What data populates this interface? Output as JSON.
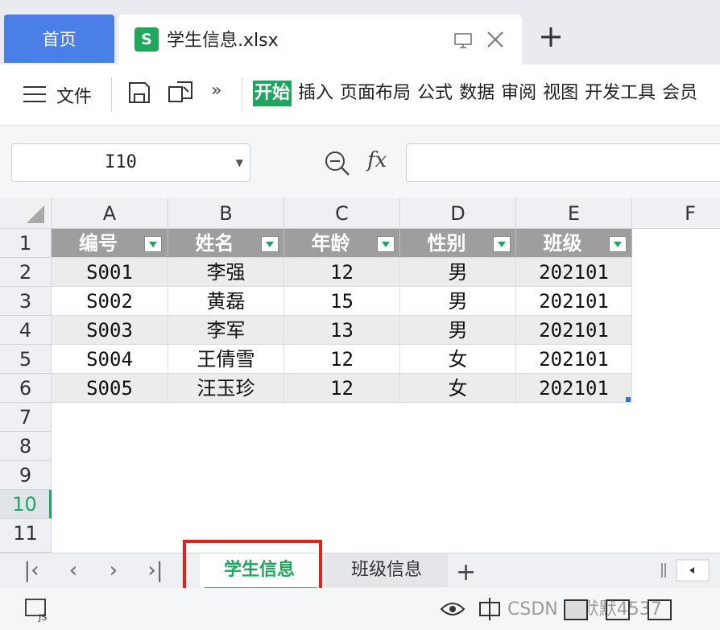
{
  "tabs": {
    "home": "首页",
    "file_icon": "S",
    "file_name": "学生信息.xlsx"
  },
  "ribbon": {
    "file_menu": "文件",
    "tabs": [
      "开始",
      "插入",
      "页面布局",
      "公式",
      "数据",
      "审阅",
      "视图",
      "开发工具",
      "会员"
    ]
  },
  "formula_bar": {
    "cell_ref": "I10",
    "fx": "fx",
    "formula": ""
  },
  "grid": {
    "columns": [
      "A",
      "B",
      "C",
      "D",
      "E",
      "F"
    ],
    "rows": [
      "1",
      "2",
      "3",
      "4",
      "5",
      "6",
      "7",
      "8",
      "9",
      "10",
      "11"
    ],
    "active_row": "10",
    "headers": [
      "编号",
      "姓名",
      "年龄",
      "性别",
      "班级"
    ],
    "data": [
      [
        "S001",
        "李强",
        "12",
        "男",
        "202101"
      ],
      [
        "S002",
        "黄磊",
        "15",
        "男",
        "202101"
      ],
      [
        "S003",
        "李军",
        "13",
        "男",
        "202101"
      ],
      [
        "S004",
        "王倩雪",
        "12",
        "女",
        "202101"
      ],
      [
        "S005",
        "汪玉珍",
        "12",
        "女",
        "202101"
      ]
    ]
  },
  "sheets": {
    "active": "学生信息",
    "inactive": "班级信息",
    "add": "+"
  },
  "status": {
    "watermark": "CSDN @默默4537"
  },
  "colors": {
    "accent": "#1fa55e",
    "home_tab": "#4a7fe8",
    "header_fill": "#9e9e9e",
    "highlight": "#e0241c"
  }
}
